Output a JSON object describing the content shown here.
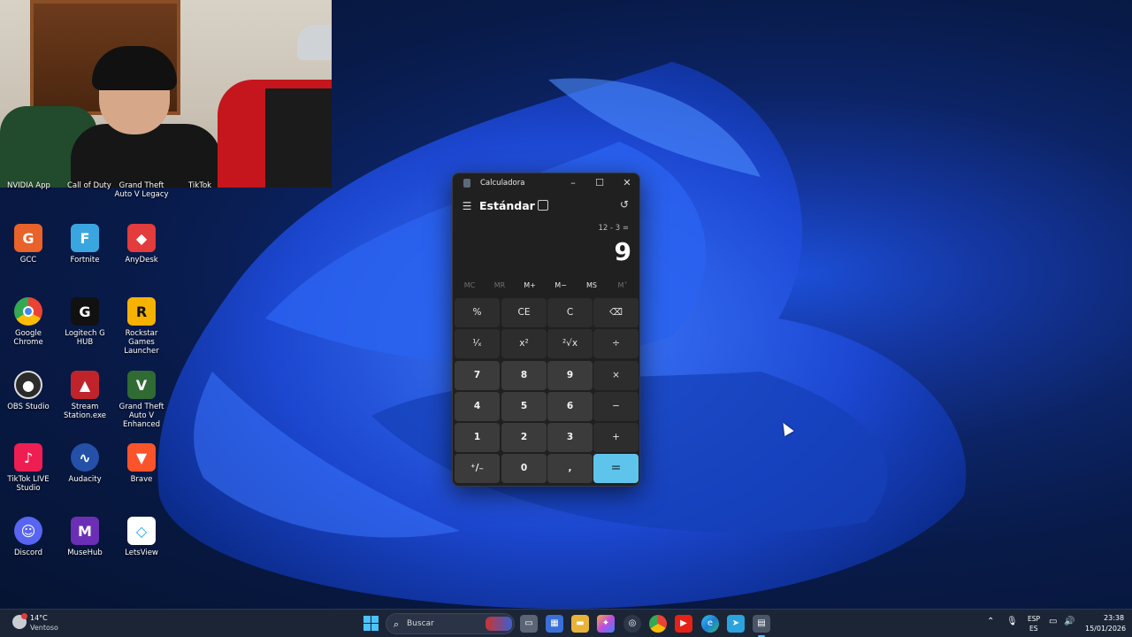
{
  "desktop": {
    "partial_labels": [
      "NVIDIA App",
      "Call of Duty",
      "Grand Theft Auto V Legacy",
      "TikTok"
    ],
    "icons": [
      {
        "label": "GCC",
        "icon": "gcc-icon",
        "color": "#e8622a"
      },
      {
        "label": "Fortnite",
        "icon": "fortnite-icon",
        "color": "#3aa6e0"
      },
      {
        "label": "AnyDesk",
        "icon": "anydesk-icon",
        "color": "#e23c3c"
      },
      {
        "label": "Google Chrome",
        "icon": "chrome-icon",
        "color": "#34a853"
      },
      {
        "label": "Logitech G HUB",
        "icon": "logitech-icon",
        "color": "#111111"
      },
      {
        "label": "Rockstar Games Launcher",
        "icon": "rockstar-icon",
        "color": "#f5b300"
      },
      {
        "label": "OBS Studio",
        "icon": "obs-icon",
        "color": "#2b2b2b"
      },
      {
        "label": "Stream Station.exe",
        "icon": "stream-station-icon",
        "color": "#c0242a"
      },
      {
        "label": "Grand Theft Auto V Enhanced",
        "icon": "gta-icon",
        "color": "#2f6b32"
      },
      {
        "label": "TikTok LIVE Studio",
        "icon": "tiktok-icon",
        "color": "#ee1d52"
      },
      {
        "label": "Audacity",
        "icon": "audacity-icon",
        "color": "#2450a8"
      },
      {
        "label": "Brave",
        "icon": "brave-icon",
        "color": "#fb542b"
      },
      {
        "label": "Discord",
        "icon": "discord-icon",
        "color": "#5865f2"
      },
      {
        "label": "MuseHub",
        "icon": "musehub-icon",
        "color": "#6b2fb5"
      },
      {
        "label": "LetsView",
        "icon": "letsview-icon",
        "color": "#ffffff"
      }
    ]
  },
  "calculator": {
    "title": "Calculadora",
    "mode": "Estándar",
    "expression": "12 - 3 =",
    "result": "9",
    "memory": [
      "MC",
      "MR",
      "M+",
      "M−",
      "MS",
      "M˅"
    ],
    "keys": [
      [
        "%",
        "CE",
        "C",
        "⌫"
      ],
      [
        "¹⁄ₓ",
        "x²",
        "²√x",
        "÷"
      ],
      [
        "7",
        "8",
        "9",
        "×"
      ],
      [
        "4",
        "5",
        "6",
        "−"
      ],
      [
        "1",
        "2",
        "3",
        "+"
      ],
      [
        "⁺/₋",
        "0",
        ",",
        "="
      ]
    ],
    "accent": "#5fc4ec"
  },
  "taskbar": {
    "temperature": "14°C",
    "condition": "Ventoso",
    "search_placeholder": "Buscar",
    "lang_top": "ESP",
    "lang_bottom": "ES",
    "time": "23:38",
    "date": "15/01/2026"
  }
}
